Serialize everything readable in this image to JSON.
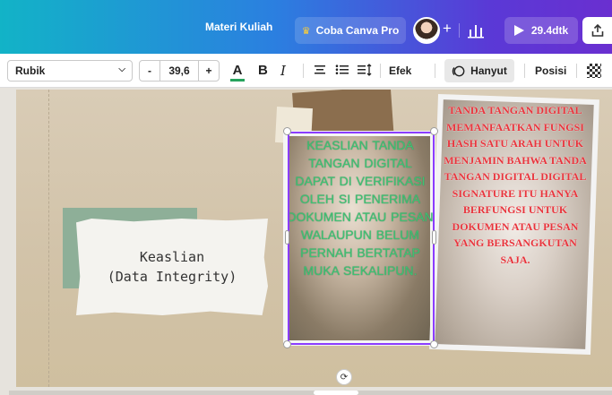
{
  "topbar": {
    "doc_title": "Materi Kuliah",
    "pro_button": "Coba Canva Pro",
    "add_label": "+",
    "play_label": "29.4dtk"
  },
  "toolbar": {
    "font": "Rubik",
    "size_minus": "-",
    "font_size": "39,6",
    "size_plus": "+",
    "text_color_label": "A",
    "bold_label": "B",
    "italic_label": "I",
    "effects_label": "Efek",
    "animate_label": "Hanyut",
    "position_label": "Posisi",
    "colors": {
      "text_color_bar": "#26a35d"
    }
  },
  "canvas": {
    "note_text": "Keaslian\n(Data Integrity)",
    "left_text": "KEASLIAN TANDA TANGAN DIGITAL DAPAT DI VERIFIKASI OLEH SI PENERIMA DOKUMEN ATAU PESAN WALAUPUN BELUM PERNAH BERTATAP MUKA SEKALIPUN.",
    "right_text": "TANDA TANGAN DIGITAL MEMANFAATKAN FUNGSI HASH SATU ARAH UNTUK MENJAMIN BAHWA TANDA TANGAN DIGITAL DIGITAL SIGNATURE ITU HANYA BERFUNGSI UNTUK DOKUMEN ATAU PESAN YANG BERSANGKUTAN SAJA.",
    "colors": {
      "left_text": "#3ec273",
      "right_text": "#e8343c",
      "selection": "#8b3dff"
    }
  }
}
